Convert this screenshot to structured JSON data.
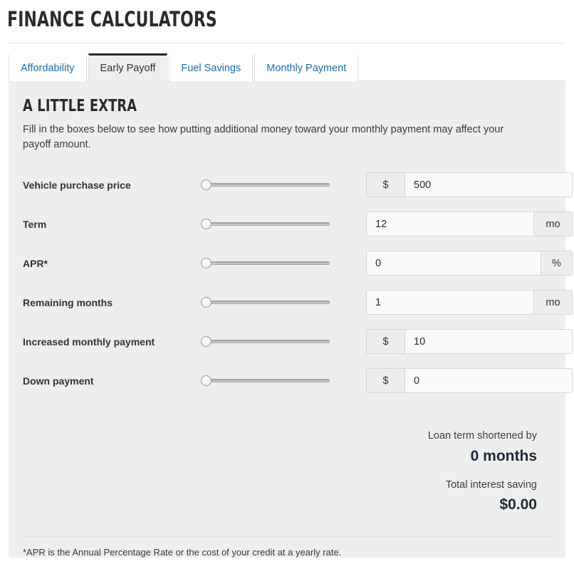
{
  "page": {
    "title": "FINANCE CALCULATORS"
  },
  "tabs": [
    {
      "label": "Affordability",
      "active": false
    },
    {
      "label": "Early Payoff",
      "active": true
    },
    {
      "label": "Fuel Savings",
      "active": false
    },
    {
      "label": "Monthly Payment",
      "active": false
    }
  ],
  "panel": {
    "heading": "A LITTLE EXTRA",
    "description": "Fill in the boxes below to see how putting additional money toward your monthly payment may affect your payoff amount."
  },
  "fields": [
    {
      "label": "Vehicle purchase price",
      "value": "500",
      "prefix": "$",
      "suffix": "",
      "slider_position": 0
    },
    {
      "label": "Term",
      "value": "12",
      "prefix": "",
      "suffix": "mo",
      "slider_position": 0
    },
    {
      "label": "APR*",
      "value": "0",
      "prefix": "",
      "suffix": "%",
      "slider_position": 0
    },
    {
      "label": "Remaining months",
      "value": "1",
      "prefix": "",
      "suffix": "mo",
      "slider_position": 0
    },
    {
      "label": "Increased monthly payment",
      "value": "10",
      "prefix": "$",
      "suffix": "",
      "slider_position": 0
    },
    {
      "label": "Down payment",
      "value": "0",
      "prefix": "$",
      "suffix": "",
      "slider_position": 0
    }
  ],
  "results": [
    {
      "label": "Loan term shortened by",
      "value": "0 months"
    },
    {
      "label": "Total interest saving",
      "value": "$0.00"
    }
  ],
  "footnote": "*APR is the Annual Percentage Rate or the cost of your credit at a yearly rate.",
  "colors": {
    "tab_link": "#1c6ca8",
    "active_tab_border": "#1f2d3d",
    "result_value": "#1c2b39",
    "panel_background": "#eeeeee"
  }
}
